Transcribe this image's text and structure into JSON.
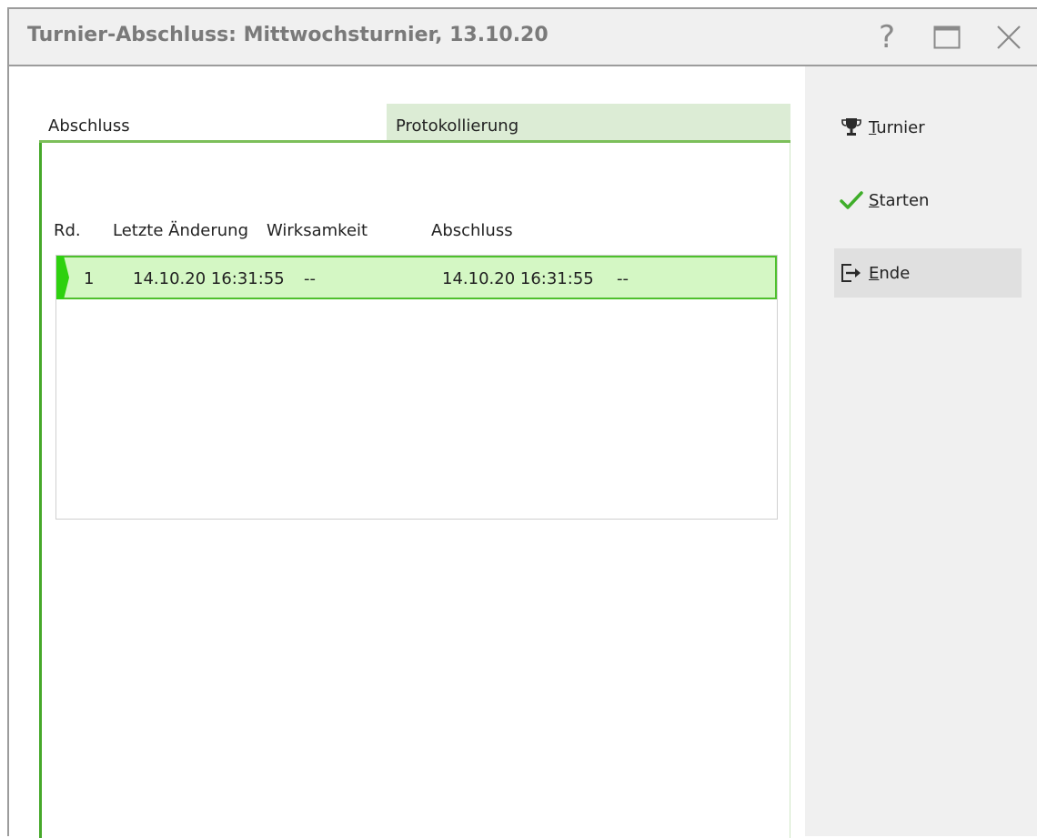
{
  "window": {
    "title": "Turnier-Abschluss: Mittwochsturnier, 13.10.20",
    "help_glyph": "?"
  },
  "tabs": [
    {
      "label": "Abschluss",
      "active": true
    },
    {
      "label": "Protokollierung",
      "active": false
    }
  ],
  "table": {
    "columns": [
      "Rd.",
      "Letzte Änderung",
      "Wirksamkeit",
      "Abschluss"
    ],
    "rows": [
      {
        "rd": "1",
        "letzte_aenderung": "14.10.20 16:31:55",
        "wirksamkeit": "--",
        "abschluss": "14.10.20 16:31:55",
        "extra": "--",
        "selected": true
      }
    ]
  },
  "side_buttons": [
    {
      "underline": "T",
      "rest": "urnier",
      "icon": "trophy-icon"
    },
    {
      "underline": "S",
      "rest": "tarten",
      "icon": "checkmark-icon"
    },
    {
      "underline": "E",
      "rest": "nde",
      "icon": "exit-icon",
      "active": true
    }
  ],
  "colors": {
    "accent_green": "#46a82a",
    "row_selected_bg": "#d4f7c4",
    "tab_inactive_bg": "#dcecd5",
    "panel_bg": "#f0f0f0"
  }
}
